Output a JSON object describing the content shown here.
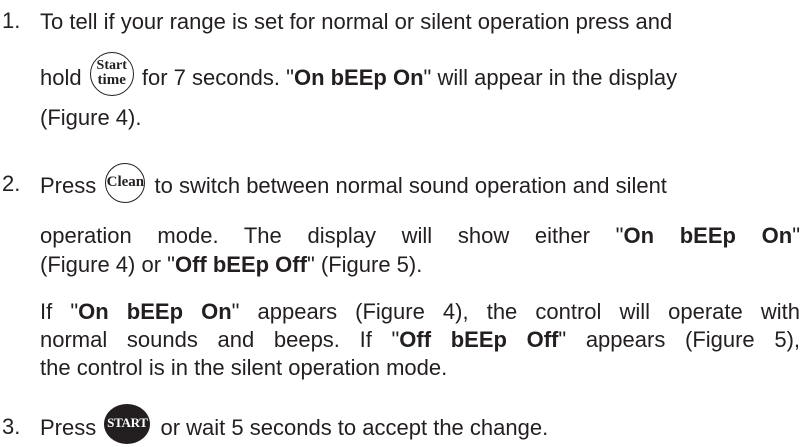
{
  "step1": {
    "number": "1.",
    "line1": "To tell if your range is set for normal or silent operation press and",
    "line2_pre": "hold",
    "key_start_time_line1": "Start",
    "key_start_time_line2": "time",
    "line2_mid": "for 7 seconds. \"",
    "line2_bold": "On bEEp On",
    "line2_post": "\" will appear in the display",
    "line3": "(Figure 4)."
  },
  "step2": {
    "number": "2.",
    "line1_pre": "Press",
    "key_clean": "Clean",
    "line1_post": "to switch between normal sound operation and silent",
    "line2_pre": "operation mode. The display will show either \"",
    "line2_bold": "On bEEp On",
    "line2_post": "\"",
    "line3_pre": "(Figure 4) or \"",
    "line3_bold": "Off bEEp Off",
    "line3_post": "\" (Figure 5).",
    "para2_line1_pre": "If \"",
    "para2_line1_bold1": "On bEEp On",
    "para2_line1_mid": "\" appears (Figure 4), the control will operate with",
    "para2_line2_pre": "normal sounds and beeps. If \"",
    "para2_line2_bold": "Off bEEp Off",
    "para2_line2_post": "\" appears (Figure 5),",
    "para2_line3": "the control is in the silent operation mode."
  },
  "step3": {
    "number": "3.",
    "line1_pre": "Press",
    "key_start": "START",
    "line1_post": "or wait 5 seconds to accept the change."
  }
}
